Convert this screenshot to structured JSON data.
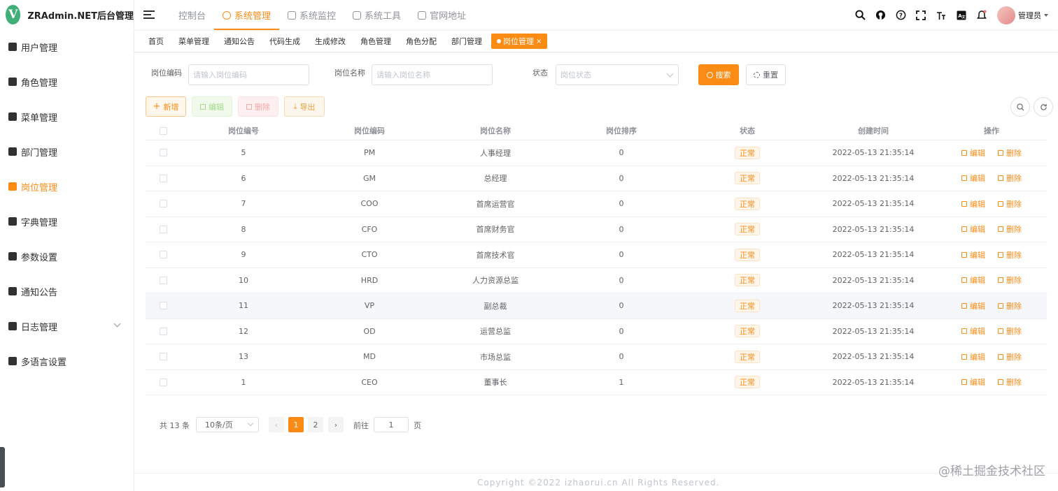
{
  "app": {
    "logo_letter": "V",
    "title": "ZRAdmin.NET后台管理"
  },
  "sidebar": {
    "items": [
      {
        "label": "用户管理",
        "icon": "user-icon",
        "active": false
      },
      {
        "label": "角色管理",
        "icon": "peoples-icon",
        "active": false
      },
      {
        "label": "菜单管理",
        "icon": "tree-table-icon",
        "active": false
      },
      {
        "label": "部门管理",
        "icon": "tree-icon",
        "active": false
      },
      {
        "label": "岗位管理",
        "icon": "post-icon",
        "active": true
      },
      {
        "label": "字典管理",
        "icon": "dict-icon",
        "active": false
      },
      {
        "label": "参数设置",
        "icon": "edit-icon",
        "active": false
      },
      {
        "label": "通知公告",
        "icon": "message-icon",
        "active": false
      },
      {
        "label": "日志管理",
        "icon": "log-icon",
        "active": false,
        "expandable": true
      },
      {
        "label": "多语言设置",
        "icon": "language-icon",
        "active": false
      }
    ]
  },
  "topnav": {
    "items": [
      {
        "label": "控制台",
        "active": false
      },
      {
        "label": "系统管理",
        "active": true
      },
      {
        "label": "系统监控",
        "active": false
      },
      {
        "label": "系统工具",
        "active": false
      },
      {
        "label": "官网地址",
        "active": false
      }
    ],
    "tools": [
      "search-icon",
      "github-icon",
      "question-icon",
      "fullscreen-icon",
      "font-size-icon",
      "language-icon",
      "bell-icon"
    ],
    "username": "管理员"
  },
  "tags": [
    {
      "label": "首页",
      "active": false
    },
    {
      "label": "菜单管理",
      "active": false
    },
    {
      "label": "通知公告",
      "active": false
    },
    {
      "label": "代码生成",
      "active": false
    },
    {
      "label": "生成修改",
      "active": false
    },
    {
      "label": "角色管理",
      "active": false
    },
    {
      "label": "角色分配",
      "active": false
    },
    {
      "label": "部门管理",
      "active": false
    },
    {
      "label": "岗位管理",
      "active": true,
      "close": "×"
    }
  ],
  "form": {
    "post_code_label": "岗位编码",
    "post_code_placeholder": "请输入岗位编码",
    "post_name_label": "岗位名称",
    "post_name_placeholder": "请输入岗位名称",
    "status_label": "状态",
    "status_placeholder": "岗位状态",
    "search_label": "搜索",
    "reset_label": "重置"
  },
  "toolbar": {
    "add_label": "新增",
    "edit_label": "编辑",
    "delete_label": "删除",
    "export_label": "导出"
  },
  "table": {
    "headers": [
      "岗位编号",
      "岗位编码",
      "岗位名称",
      "岗位排序",
      "状态",
      "创建时间",
      "操作"
    ],
    "edit_label": "编辑",
    "delete_label": "删除",
    "rows": [
      {
        "id": "5",
        "code": "PM",
        "name": "人事经理",
        "sort": "0",
        "status": "正常",
        "created": "2022-05-13 21:35:14"
      },
      {
        "id": "6",
        "code": "GM",
        "name": "总经理",
        "sort": "0",
        "status": "正常",
        "created": "2022-05-13 21:35:14"
      },
      {
        "id": "7",
        "code": "COO",
        "name": "首席运营官",
        "sort": "0",
        "status": "正常",
        "created": "2022-05-13 21:35:14"
      },
      {
        "id": "8",
        "code": "CFO",
        "name": "首席财务官",
        "sort": "0",
        "status": "正常",
        "created": "2022-05-13 21:35:14"
      },
      {
        "id": "9",
        "code": "CTO",
        "name": "首席技术官",
        "sort": "0",
        "status": "正常",
        "created": "2022-05-13 21:35:14"
      },
      {
        "id": "10",
        "code": "HRD",
        "name": "人力资源总监",
        "sort": "0",
        "status": "正常",
        "created": "2022-05-13 21:35:14"
      },
      {
        "id": "11",
        "code": "VP",
        "name": "副总裁",
        "sort": "0",
        "status": "正常",
        "created": "2022-05-13 21:35:14",
        "hover": true
      },
      {
        "id": "12",
        "code": "OD",
        "name": "运营总监",
        "sort": "0",
        "status": "正常",
        "created": "2022-05-13 21:35:14"
      },
      {
        "id": "13",
        "code": "MD",
        "name": "市场总监",
        "sort": "0",
        "status": "正常",
        "created": "2022-05-13 21:35:14"
      },
      {
        "id": "1",
        "code": "CEO",
        "name": "董事长",
        "sort": "1",
        "status": "正常",
        "created": "2022-05-13 21:35:14"
      }
    ]
  },
  "pagination": {
    "total_text": "共 13 条",
    "page_size": "10条/页",
    "pages": [
      "1",
      "2"
    ],
    "current": "1",
    "goto_label": "前往",
    "goto_value": "1",
    "page_unit": "页"
  },
  "footer": {
    "copyright": "Copyright ©2022 izhaorui.cn All Rights Reserved."
  },
  "watermark": "@稀土掘金技术社区",
  "colors": {
    "primary": "#fa8c16",
    "logo": "#3fae77"
  }
}
